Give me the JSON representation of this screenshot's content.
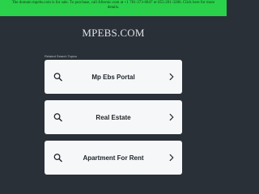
{
  "banner": {
    "line1": "The domain mpebs.com is for sale. To purchase, call Afternic.com at +1 781-373-6847 or 855-201-3286. Click here for more",
    "line2": "details."
  },
  "site": {
    "title": "MPEBS.COM"
  },
  "related": {
    "label": "Related Search Topics",
    "items": [
      {
        "label": "Mp Ebs Portal"
      },
      {
        "label": "Real Estate"
      },
      {
        "label": "Apartment For Rent"
      }
    ]
  },
  "icons": {
    "search": "search-icon",
    "chevron": "chevron-right-icon"
  },
  "colors": {
    "background": "#2a3038",
    "banner": "#29d24a",
    "card": "#f6f7f8"
  }
}
